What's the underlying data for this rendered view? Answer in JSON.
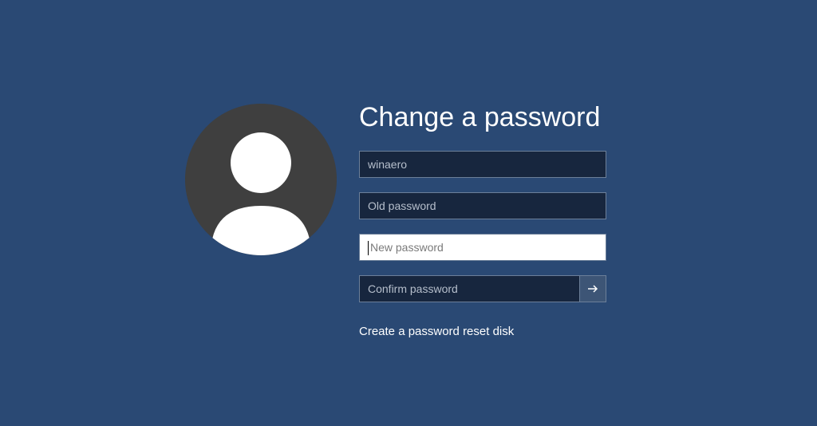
{
  "title": "Change a password",
  "username": {
    "value": "winaero"
  },
  "old_password": {
    "placeholder": "Old password"
  },
  "new_password": {
    "placeholder": "New password"
  },
  "confirm_password": {
    "placeholder": "Confirm password"
  },
  "reset_link": "Create a password reset disk",
  "icons": {
    "submit": "arrow-right-icon"
  },
  "colors": {
    "background": "#2a4974",
    "field_dark": "#17263e",
    "field_light": "#ffffff",
    "avatar_bg": "#3f3f3f"
  }
}
